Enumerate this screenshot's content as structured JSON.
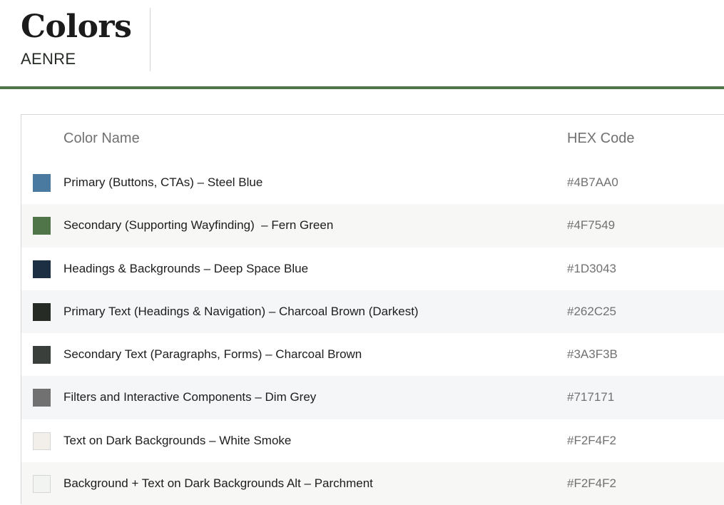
{
  "header": {
    "title": "Colors",
    "subtitle": "AENRE"
  },
  "table": {
    "columns": {
      "name": "Color Name",
      "hex": "HEX Code"
    },
    "rows": [
      {
        "name": "Primary (Buttons, CTAs) – Steel Blue",
        "hex": "#4B7AA0",
        "swatch": "#4B7AA0"
      },
      {
        "name": "Secondary (Supporting Wayfinding)  – Fern Green",
        "hex": "#4F7549",
        "swatch": "#4F7549"
      },
      {
        "name": "Headings & Backgrounds – Deep Space Blue",
        "hex": "#1D3043",
        "swatch": "#1D3043"
      },
      {
        "name": "Primary Text (Headings & Navigation) – Charcoal Brown (Darkest)",
        "hex": "#262C25",
        "swatch": "#262C25"
      },
      {
        "name": "Secondary Text (Paragraphs, Forms) – Charcoal Brown",
        "hex": "#3A3F3B",
        "swatch": "#3A3F3B"
      },
      {
        "name": "Filters and Interactive Components – Dim Grey",
        "hex": "#717171",
        "swatch": "#717171"
      },
      {
        "name": "Text on Dark Backgrounds – White Smoke",
        "hex": "#F2F4F2",
        "swatch": "#F2EFEA"
      },
      {
        "name": "Background + Text on Dark Backgrounds Alt – Parchment",
        "hex": "#F2F4F2",
        "swatch": "#F2F4F2"
      }
    ]
  },
  "colors": {
    "accent_rule": "#4F7549"
  }
}
